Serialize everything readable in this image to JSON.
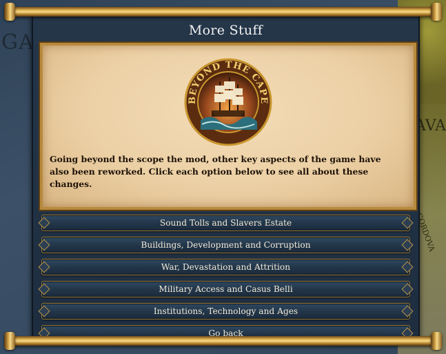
{
  "map": {
    "left_label": "GA",
    "right_label": "AVA",
    "right_label_small": "CORDOVA"
  },
  "dialog": {
    "title": "More Stuff",
    "logo_text": "BEYOND THE CAPE",
    "description": "Going beyond the scope the mod, other key aspects of the game have also been reworked. Click each option below to see all about these changes."
  },
  "options": [
    {
      "label": "Sound Tolls and Slavers Estate"
    },
    {
      "label": "Buildings, Development and Corruption"
    },
    {
      "label": "War, Devastation and Attrition"
    },
    {
      "label": "Military Access and Casus Belli"
    },
    {
      "label": "Institutions, Technology and Ages"
    },
    {
      "label": "Go back"
    }
  ],
  "colors": {
    "accent_gold": "#b88a3c",
    "panel": "#223548",
    "parchment": "#ecd0a5"
  }
}
